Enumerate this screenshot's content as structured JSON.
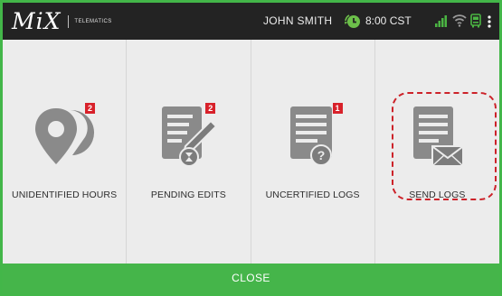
{
  "header": {
    "logo_text": "MiX",
    "logo_subtext": "TELEMATICS",
    "user_name": "JOHN SMITH",
    "time": "8:00 CST",
    "icons": [
      "status-clock-icon",
      "signal-icon",
      "wifi-icon",
      "truck-icon",
      "menu-icon"
    ]
  },
  "tiles": [
    {
      "label": "UNIDENTIFIED HOURS",
      "badge": "2",
      "icon": "location-pin-icon"
    },
    {
      "label": "PENDING EDITS",
      "badge": "2",
      "icon": "edit-document-icon"
    },
    {
      "label": "UNCERTIFIED LOGS",
      "badge": "1",
      "icon": "log-question-icon"
    },
    {
      "label": "SEND LOGS",
      "badge": "",
      "icon": "send-log-icon",
      "highlighted": true
    }
  ],
  "footer": {
    "close_label": "CLOSE"
  },
  "colors": {
    "accent_green": "#45b54a",
    "header_bg": "#232323",
    "badge_red": "#d8212a",
    "icon_gray": "#8a8a8a",
    "highlight_red": "#cc2229"
  }
}
